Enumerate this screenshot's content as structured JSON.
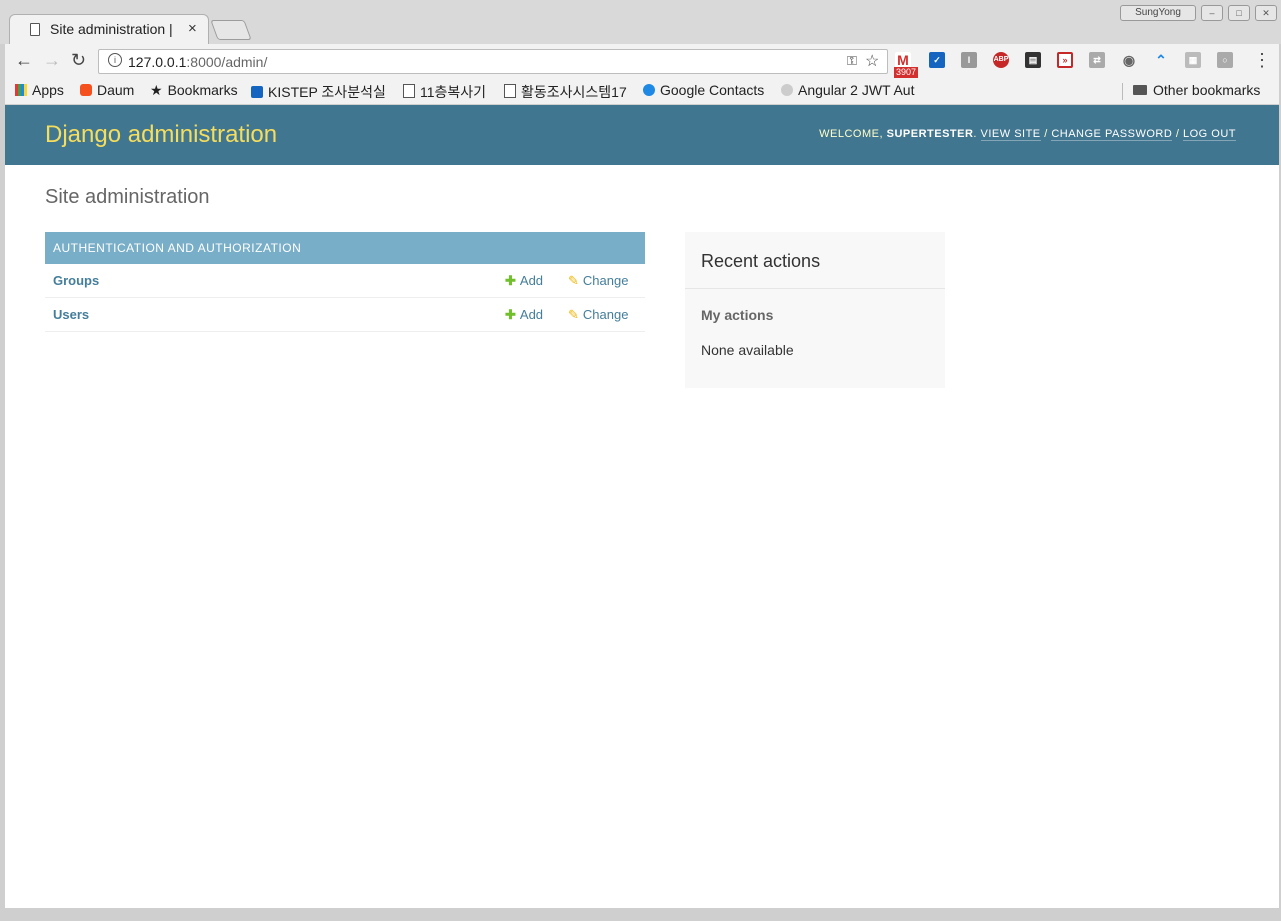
{
  "browser": {
    "tab_title": "Site administration |",
    "tab_close": "×",
    "profile": "SungYong",
    "url_host": "127.0.0.1",
    "url_rest": ":8000/admin/",
    "info_icon": "i",
    "ext_badge": "3907",
    "bookmarks": [
      "Apps",
      "Daum",
      "Bookmarks",
      "KISTEP 조사분석실",
      "11층복사기",
      "활동조사시스템17",
      "Google Contacts",
      "Angular 2 JWT Aut",
      "Other bookmarks"
    ]
  },
  "header": {
    "branding": "Django administration",
    "welcome": "Welcome,",
    "username": "SUPERTESTER",
    "view_site": "View site",
    "change_password": "Change password",
    "log_out": "Log out"
  },
  "main": {
    "title": "Site administration",
    "module": {
      "caption": "Authentication and Authorization",
      "rows": [
        {
          "name": "Groups",
          "add": "Add",
          "change": "Change"
        },
        {
          "name": "Users",
          "add": "Add",
          "change": "Change"
        }
      ]
    }
  },
  "recent": {
    "title": "Recent actions",
    "subtitle": "My actions",
    "none": "None available"
  },
  "colors": {
    "header_bg": "#417690",
    "branding": "#f5dd5d",
    "caption_bg": "#79aec8",
    "link": "#447e9b",
    "add_icon": "#70bf2b",
    "change_icon": "#efb80b"
  }
}
